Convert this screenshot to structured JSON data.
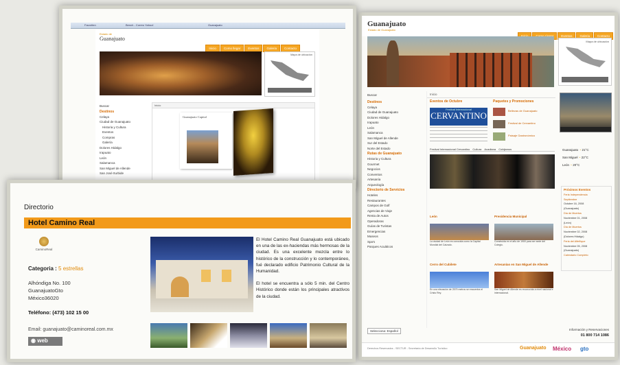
{
  "colors": {
    "accent": "#f29a1a",
    "link": "#c85f00",
    "bg": "#e9e9e4"
  },
  "screen1": {
    "browser_tabs": [
      "Favoriten",
      "Bench - Correo Yahoo!",
      "Guanajuato"
    ],
    "logo": {
      "line1": "Estado de",
      "line2": "Guanajuato"
    },
    "nav": [
      "Inicio",
      "Como llegar",
      "Eventos",
      "Galeria",
      "Contacto"
    ],
    "map_caption": "Mapa de ubicación",
    "sidebar_title": "Buscar",
    "sidebar_section": "Destinos",
    "sidebar_items": [
      "Celaya",
      "Ciudad de Guanajuato",
      "Historia y Cultura",
      "Eventos",
      "Compras",
      "Galería",
      "Dolores Hidalgo",
      "Irapuato",
      "León",
      "Salamanca",
      "San Miguel de Allende",
      "San José Iturbide"
    ],
    "breadcrumb": "Inicio",
    "book_caption": "Guanajuato Capital"
  },
  "screen2": {
    "logo": "Guanajuato",
    "logo_sub": "Estado de Guanajuato",
    "nav": [
      "Inicio",
      "Como Llegar",
      "Eventos",
      "Galeria",
      "Contacto"
    ],
    "map_caption": "Mapa de ubicación",
    "sidebar_search": "Buscar",
    "section_destinos": "Destinos",
    "destinos": [
      "Celaya",
      "Ciudad de Guanajuato",
      "Dolores Hidalgo",
      "Irapuato",
      "León",
      "Salamanca",
      "San Miguel de Allende",
      "Sur del Estado",
      "Norte del Estado"
    ],
    "section_rutas": "Rutas de Guanajuato",
    "rutas": [
      "Historia y Cultura",
      "Gourmet",
      "Negocios",
      "Conventos",
      "Artesanía",
      "Arqueología"
    ],
    "section_directorio": "Directorio de Servicios",
    "directorio": [
      "Hoteles",
      "Restaurantes",
      "Campos de Golf",
      "Agencias de Viaje",
      "Renta de Autos",
      "Operadoras",
      "Guías de Turistas",
      "Emergencias",
      "Museos",
      "Spa's",
      "Parques Acuáticos"
    ],
    "breadcrumb": "Inicio",
    "center_title": "Eventos de Octubre",
    "festival_title": "CERVANTINO",
    "festival_sub": "Festival Internacional",
    "tabs": [
      "Festival Internacional Cervantino",
      "Cultura",
      "Acadiana",
      "Cobijamos"
    ],
    "packages_title": "Paquetes y Promociones",
    "packages": [
      "Bellezas de Guanajuato",
      "Festival de Cervantino",
      "Paisaje Gastronómico"
    ],
    "weather": [
      {
        "city": "Guanajuato",
        "temp": "21°C"
      },
      {
        "city": "San Miguel",
        "temp": "22°C"
      },
      {
        "city": "León",
        "temp": "20°C"
      }
    ],
    "events_title": "Próximos Eventos",
    "events": [
      "Feria Independencia",
      "Septiembre",
      "Octubre 16, 2008",
      "(Guanajuato)",
      "Día de Muertos",
      "Noviembre 01, 2008",
      "(León)",
      "Día de Muertos",
      "Noviembre 02, 2008",
      "(Dolores Hidalgo)",
      "Feria del Alfeñique",
      "Noviembre 05, 2008",
      "(Guanajuato)",
      "Calendario Completo"
    ],
    "blocks": [
      {
        "title": "León",
        "text": "La ciudad de León es conocida como la Capital Mundial del Calzado."
      },
      {
        "title": "Presidencia Municipal",
        "text": "Construida en el año de 1900 para ser sede del Colegio."
      },
      {
        "title": "Cerro del Cubilete",
        "text": "En una elevación de 2579 metros se encuentra el Cristo Rey."
      },
      {
        "title": "Artesanías en San Miguel de Allende",
        "text": "San Miguel de Allende es reconocida a nivel nacional e internacional."
      }
    ],
    "language_label": "Selecciona: Español",
    "info_label": "Información y Reservaciones",
    "phone": "01 800 714 1086",
    "footer_text": "Derechos Reservados - SECTUR - Secretaría de Desarrollo Turístico",
    "footer_logos": [
      "Guanajuato",
      "México",
      "gto"
    ]
  },
  "hotel": {
    "header": "Directorio",
    "title": "Hotel Camino Real",
    "logo_text": "CaminoReal",
    "category_label": "Categoria :",
    "category_value": "5 estrellas",
    "address_1": "Alhóndiga No. 100",
    "address_2": "GuanajuatoGto",
    "address_3": "México36020",
    "phone": "Teléfono: (473) 102 15 00",
    "email": "Email: guanajuato@caminoreal.com.mx",
    "web_button": "web",
    "desc_1": "El Hotel Camino Real Guanajuato está ubicado en una de las ex-haciendas más hermosas de la ciudad. Es una excelente mezcla entre lo histórico de la construcción y lo contemporáneo, fué declarado edificio Patrimonio Cultural de la Humanidad.",
    "desc_2": "El hotel se encuentra a sólo 5 min. del Centro Histórico donde están los principales atractivos de la ciudad."
  }
}
